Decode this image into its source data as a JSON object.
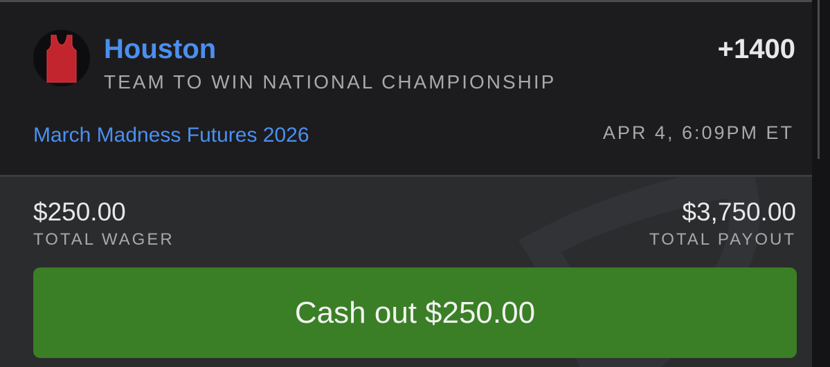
{
  "bet": {
    "team": "Houston",
    "market": "TEAM TO WIN NATIONAL CHAMPIONSHIP",
    "odds": "+1400",
    "event": "March Madness Futures 2026",
    "datetime": "APR 4, 6:09PM ET",
    "team_icon": "jersey-icon",
    "team_color": "#c3252f"
  },
  "totals": {
    "wager_amount": "$250.00",
    "wager_label": "TOTAL WAGER",
    "payout_amount": "$3,750.00",
    "payout_label": "TOTAL PAYOUT"
  },
  "cashout": {
    "label": "Cash out",
    "amount": "$250.00",
    "color": "#3a7f25"
  },
  "colors": {
    "accent": "#4b8ff0",
    "background_top": "#1c1c1e",
    "background_bottom": "#2b2c2e"
  }
}
